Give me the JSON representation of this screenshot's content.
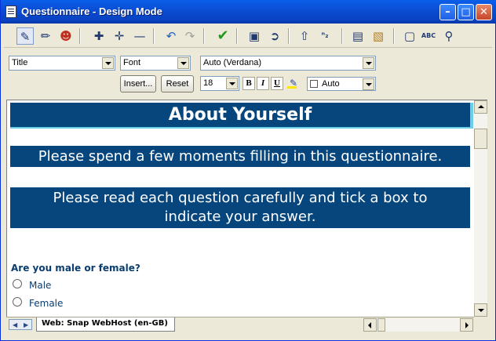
{
  "window": {
    "title": "Questionnaire - Design Mode",
    "controls": [
      "minimize-icon",
      "maximize-icon",
      "close-icon"
    ]
  },
  "toolbar": {
    "icons": [
      "design-mode-icon",
      "format-painter-icon",
      "users-icon",
      "add-question-icon",
      "add-subquestion-icon",
      "remove-icon",
      "undo-icon",
      "redo-icon",
      "check-icon",
      "properties-icon",
      "routing-icon",
      "move-up-icon",
      "renumber-icon",
      "page-icon",
      "layers-icon",
      "preview-icon",
      "spell-check-icon",
      "find-icon"
    ]
  },
  "format": {
    "style_value": "Title",
    "font_value": "Font",
    "font_name_value": "Auto (Verdana)",
    "insert_label": "Insert...",
    "reset_label": "Reset",
    "size_value": "18",
    "bold_label": "B",
    "italic_label": "I",
    "underline_label": "U",
    "color_value": "Auto"
  },
  "document": {
    "heading": "About Yourself",
    "intro1": "Please spend a few moments filling in this questionnaire.",
    "intro2_line1": "Please read each question carefully and tick a box to",
    "intro2_line2": "indicate your answer.",
    "question": "Are you male or female?",
    "options": [
      "Male",
      "Female"
    ],
    "band_color": "#06467D",
    "accent_color": "#6AD0E8"
  },
  "status": {
    "tab_label": "Web: Snap WebHost (en-GB)"
  }
}
